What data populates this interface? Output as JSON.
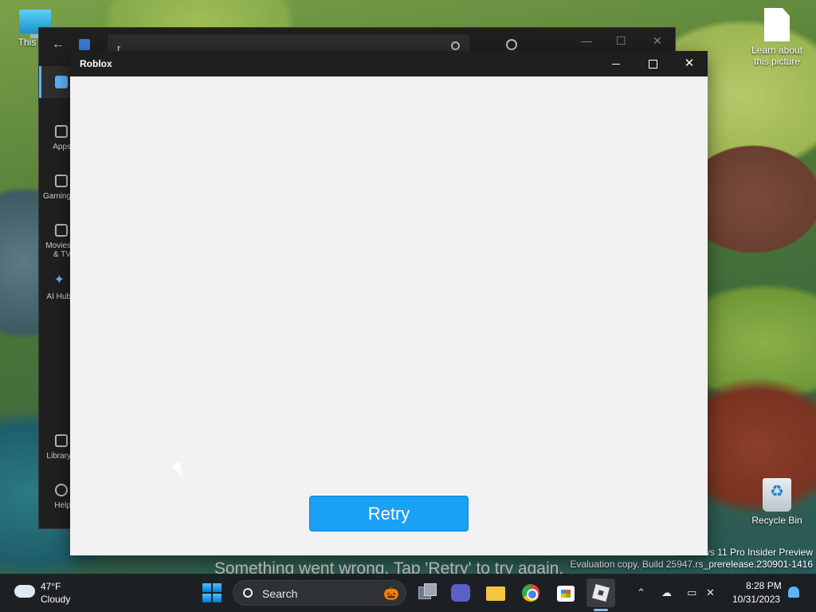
{
  "desktop": {
    "icons": [
      {
        "label": "This PC",
        "icon": "computer-icon"
      },
      {
        "label": "Learn about this picture",
        "icon": "document-icon"
      },
      {
        "label": "Recycle Bin",
        "icon": "recycle-bin-icon"
      }
    ],
    "watermark": {
      "line1": "Windows 11 Pro Insider Preview",
      "line2": "Evaluation copy. Build 25947.rs_prerelease.230901-1416"
    }
  },
  "store_window": {
    "search_value": "r",
    "nav": [
      {
        "label": "Home",
        "icon": "home-icon"
      },
      {
        "label": "Apps",
        "icon": "apps-icon"
      },
      {
        "label": "Gaming",
        "icon": "gamepad-icon"
      },
      {
        "label": "Movies & TV",
        "icon": "movies-icon"
      },
      {
        "label": "AI Hub",
        "icon": "sparkle-icon"
      },
      {
        "label": "Library",
        "icon": "library-icon"
      },
      {
        "label": "Help",
        "icon": "help-icon"
      }
    ]
  },
  "roblox_window": {
    "title": "Roblox",
    "retry_label": "Retry",
    "error_message": "Something went wrong. Tap 'Retry' to try again.",
    "accent": "#1aa0f5"
  },
  "taskbar": {
    "weather": {
      "temp": "47°F",
      "desc": "Cloudy"
    },
    "search_label": "Search",
    "apps": [
      "task-view-icon",
      "meet-icon",
      "file-explorer-icon",
      "chrome-icon",
      "microsoft-store-icon",
      "roblox-icon"
    ],
    "clock": {
      "time": "8:28 PM",
      "date": "10/31/2023"
    }
  }
}
